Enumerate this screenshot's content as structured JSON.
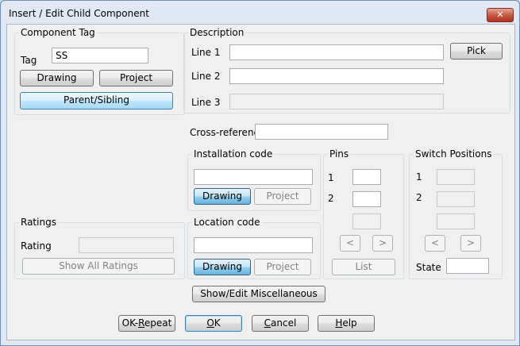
{
  "window": {
    "title": "Insert / Edit Child Component"
  },
  "component_tag": {
    "group_label": "Component Tag",
    "tag_label": "Tag",
    "tag_value": "SS",
    "drawing_button": "Drawing",
    "project_button": "Project",
    "parent_sibling_button": "Parent/Sibling"
  },
  "description": {
    "group_label": "Description",
    "line1_label": "Line 1",
    "line2_label": "Line 2",
    "line3_label": "Line 3",
    "line1_value": "",
    "line2_value": "",
    "line3_value": "",
    "pick_button": "Pick"
  },
  "cross_reference": {
    "label": "Cross-reference",
    "value": ""
  },
  "installation_code": {
    "group_label": "Installation code",
    "value": "",
    "drawing_button": "Drawing",
    "project_button": "Project"
  },
  "location_code": {
    "group_label": "Location code",
    "value": "",
    "drawing_button": "Drawing",
    "project_button": "Project"
  },
  "pins": {
    "group_label": "Pins",
    "pin1_label": "1",
    "pin2_label": "2",
    "prev_button": "<",
    "next_button": ">",
    "list_button": "List"
  },
  "switch_positions": {
    "group_label": "Switch Positions",
    "pos1_label": "1",
    "pos2_label": "2",
    "prev_button": "<",
    "next_button": ">",
    "state_label": "State",
    "state_value": ""
  },
  "ratings": {
    "group_label": "Ratings",
    "rating_label": "Rating",
    "rating_value": "",
    "show_all_button": "Show All Ratings"
  },
  "misc_button": "Show/Edit Miscellaneous",
  "footer": {
    "ok_repeat_prefix": "OK-",
    "ok_repeat_mnemonic": "R",
    "ok_repeat_suffix": "epeat",
    "ok_mnemonic": "O",
    "ok_suffix": "K",
    "cancel_mnemonic": "C",
    "cancel_suffix": "ancel",
    "help_mnemonic": "H",
    "help_suffix": "elp"
  },
  "icons": {
    "close": "close-icon"
  }
}
